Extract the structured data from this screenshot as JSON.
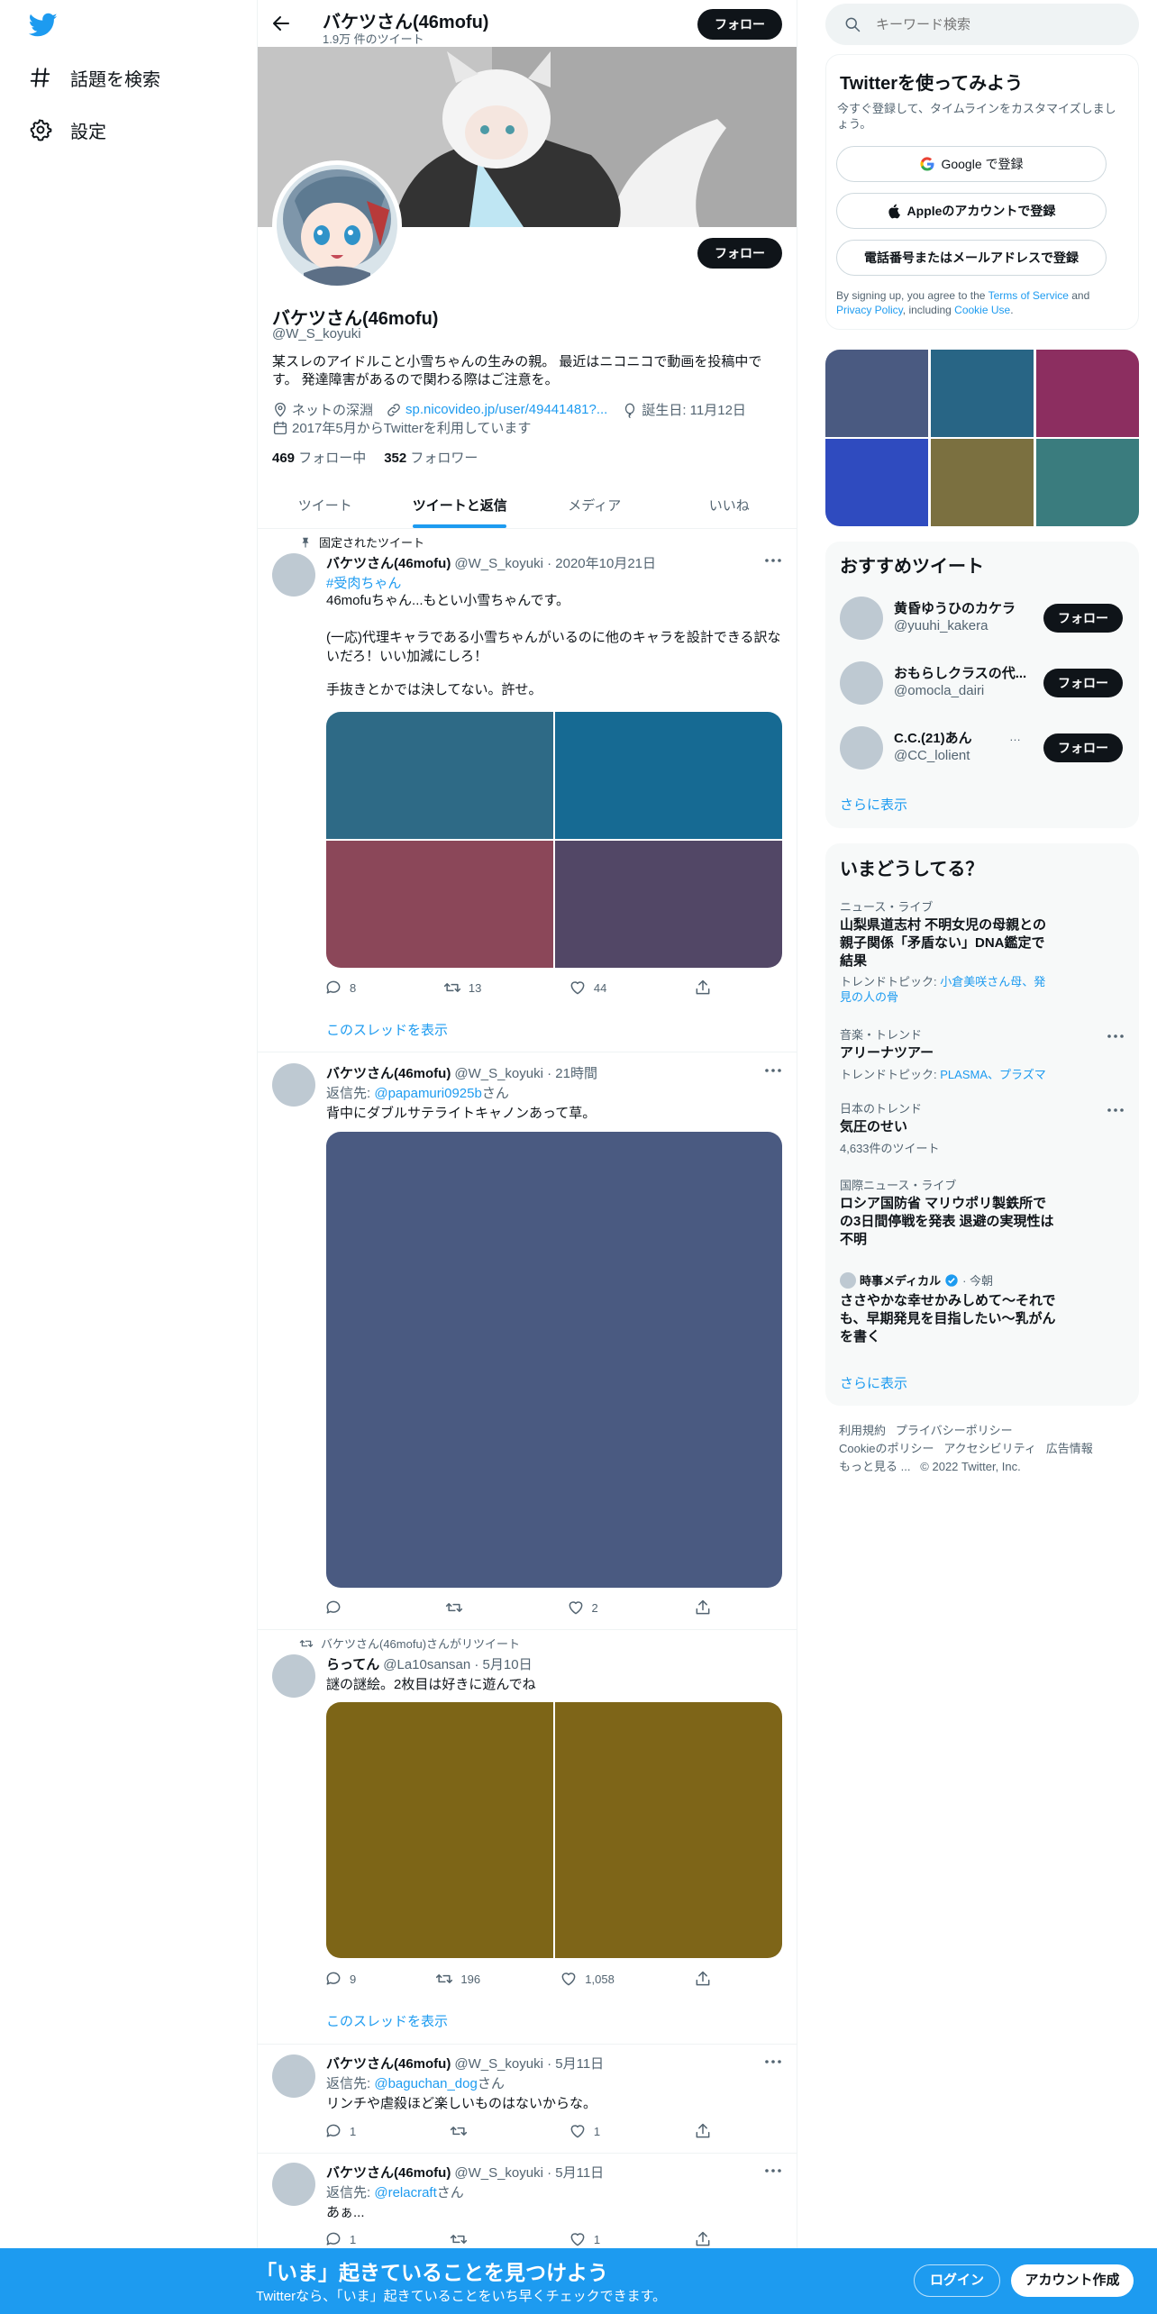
{
  "nav": {
    "explore": "話題を検索",
    "settings": "設定"
  },
  "header": {
    "name": "バケツさん(46mofu)",
    "tweet_count": "1.9万 件のツイート",
    "follow": "フォロー"
  },
  "profile": {
    "follow": "フォロー",
    "name": "バケツさん(46mofu)",
    "handle": "@W_S_koyuki",
    "bio": "某スレのアイドルこと小雪ちゃんの生みの親。 最近はニコニコで動画を投稿中です。 発達障害があるので関わる際はご注意を。",
    "location": "ネットの深淵",
    "link": "sp.nicovideo.jp/user/49441481?...",
    "birthday": "誕生日: 11月12日",
    "joined": "2017年5月からTwitterを利用しています",
    "following_count": "469",
    "following_label": "フォロー中",
    "followers_count": "352",
    "followers_label": "フォロワー"
  },
  "tabs": [
    "ツイート",
    "ツイートと返信",
    "メディア",
    "いいね"
  ],
  "tweets": [
    {
      "context": "固定されたツイート",
      "name": "バケツさん(46mofu)",
      "meta": "@W_S_koyuki · 2020年10月21日",
      "hashtag": "#受肉ちゃん",
      "text1": "46mofuちゃん...もとい小雪ちゃんです。",
      "text2": "(一応)代理キャラである小雪ちゃんがいるのに他のキャラを設計できる訳ないだろ！いい加減にしろ！",
      "text3": "手抜きとかでは決してない。許せ。",
      "replies": "8",
      "retweets": "13",
      "likes": "44",
      "thread": "このスレッドを表示",
      "colors": [
        "#2e6a86",
        "#166a93",
        "#8b4759",
        "#524766"
      ]
    },
    {
      "name": "バケツさん(46mofu)",
      "meta": "@W_S_koyuki · 21時間",
      "reply_prefix": "返信先:",
      "reply_to": "@papamuri0925b",
      "reply_suffix": "さん",
      "text1": "背中にダブルサテライトキャノンあって草。",
      "replies": "",
      "retweets": "",
      "likes": "2",
      "colors": [
        "#4a5a81"
      ]
    },
    {
      "context": "バケツさん(46mofu)さんがリツイート",
      "name": "らってん",
      "meta": "@La10sansan · 5月10日",
      "text1": "謎の謎絵。2枚目は好きに遊んでね",
      "replies": "9",
      "retweets": "196",
      "likes": "1,058",
      "thread": "このスレッドを表示",
      "colors": [
        "#7d6517",
        "#7e6518"
      ]
    },
    {
      "name": "バケツさん(46mofu)",
      "meta": "@W_S_koyuki · 5月11日",
      "reply_prefix": "返信先:",
      "reply_to": "@baguchan_dog",
      "reply_suffix": "さん",
      "text1": "リンチや虐殺ほど楽しいものはないからな。",
      "replies": "1",
      "retweets": "",
      "likes": "1"
    },
    {
      "name": "バケツさん(46mofu)",
      "meta": "@W_S_koyuki · 5月11日",
      "reply_prefix": "返信先:",
      "reply_to": "@relacraft",
      "reply_suffix": "さん",
      "text1": "あぁ...",
      "replies": "1",
      "retweets": "",
      "likes": "1"
    }
  ],
  "search": {
    "placeholder": "キーワード検索"
  },
  "signup": {
    "title": "Twitterを使ってみよう",
    "subtitle": "今すぐ登録して、タイムラインをカスタマイズしましょう。",
    "google": "Google で登録",
    "apple": "Appleのアカウントで登録",
    "phone": "電話番号またはメールアドレスで登録",
    "legal_1": "By signing up, you agree to the ",
    "legal_tos": "Terms of Service",
    "legal_2": " and ",
    "legal_pp": "Privacy Policy",
    "legal_3": ", including ",
    "legal_cookie": "Cookie Use",
    "legal_4": "."
  },
  "media_grid_colors": [
    "#4a5a81",
    "#286585",
    "#8c2e60",
    "#2f4bbf",
    "#7b7040",
    "#3a7c7e"
  ],
  "recommended": {
    "title": "おすすめツイート",
    "users": [
      {
        "name": "黄昏ゆうひのカケラ",
        "handle": "@yuuhi_kakera",
        "button": "フォロー"
      },
      {
        "name": "おもらしクラスの代...",
        "handle": "@omocla_dairi",
        "button": "フォロー"
      },
      {
        "name": "C.C.(21)あん",
        "handle": "@CC_lolient",
        "button": "フォロー"
      }
    ],
    "more": "さらに表示"
  },
  "trends": {
    "title": "いまどうしてる？",
    "items": [
      {
        "meta": "ニュース・ライブ",
        "title": "山梨県道志村 不明女児の母親との親子関係「矛盾ない」DNA鑑定で結果",
        "topic_label": "トレンドトピック:",
        "topic": "小倉美咲さん母、発見の人の骨"
      },
      {
        "meta": "音楽・トレンド",
        "title": "アリーナツアー",
        "topic_label": "トレンドトピック:",
        "topic": "PLASMA、プラズマ"
      },
      {
        "meta": "日本のトレンド",
        "title": "気圧のせい",
        "count": "4,633件のツイート"
      },
      {
        "meta": "国際ニュース・ライブ",
        "title": "ロシア国防省 マリウポリ製鉄所での3日間停戦を発表 退避の実現性は不明"
      },
      {
        "source": "時事メディカル",
        "time": "· 今朝",
        "title": "ささやかな幸せかみしめて～それでも、早期発見を目指したい～乳がんを書く"
      }
    ],
    "more": "さらに表示"
  },
  "footer": {
    "line1": [
      "利用規約",
      "プライバシーポリシー"
    ],
    "line2": [
      "Cookieのポリシー",
      "アクセシビリティ",
      "広告情報"
    ],
    "more": "もっと見る ...",
    "copyright": "© 2022 Twitter, Inc."
  },
  "bottom": {
    "title": "「いま」起きていることを見つけよう",
    "subtitle": "Twitterなら、「いま」起きていることをいち早くチェックできます。",
    "login": "ログイン",
    "signup": "アカウント作成"
  },
  "colors": {
    "accent": "#1d9bf0",
    "text": "#0f1419",
    "muted": "#536471"
  }
}
